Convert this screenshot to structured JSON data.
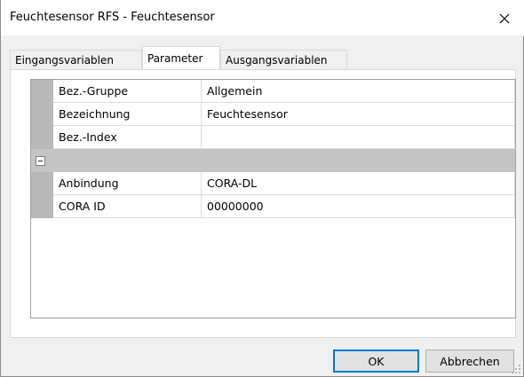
{
  "window": {
    "title": "Feuchtesensor RFS - Feuchtesensor"
  },
  "tabs": [
    {
      "label": "Eingangsvariablen",
      "active": false
    },
    {
      "label": "Parameter",
      "active": true
    },
    {
      "label": "Ausgangsvariablen",
      "active": false
    }
  ],
  "grid": {
    "rows": [
      {
        "name": "Bez.-Gruppe",
        "value": "Allgemein"
      },
      {
        "name": "Bezeichnung",
        "value": "Feuchtesensor"
      },
      {
        "name": "Bez.-Index",
        "value": ""
      }
    ],
    "group_rows": [
      {
        "name": "Anbindung",
        "value": "CORA-DL"
      },
      {
        "name": "CORA ID",
        "value": "00000000"
      }
    ]
  },
  "buttons": {
    "ok_label": "OK",
    "cancel_label": "Abbrechen"
  },
  "icons": {
    "close": "close-icon",
    "collapse": "collapse-minus-icon",
    "size_grip": "size-grip-icon"
  },
  "colors": {
    "default_button_border": "#0078d7",
    "row_gutter": "#b9b9b9",
    "group_header": "#c4c4c4"
  }
}
